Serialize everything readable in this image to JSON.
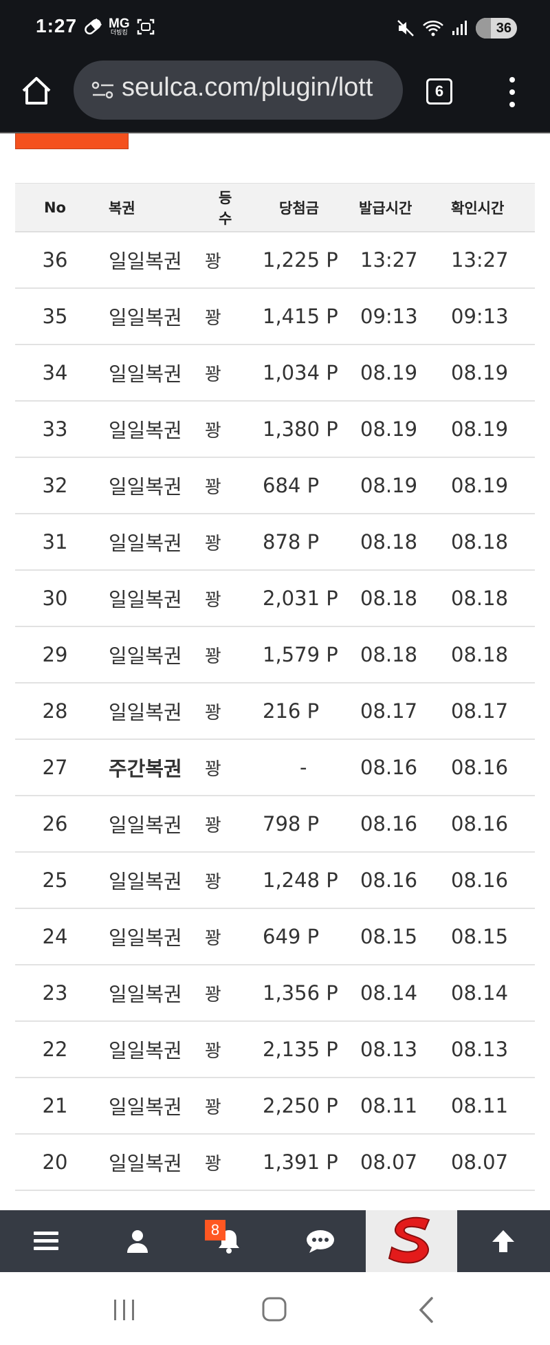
{
  "status_bar": {
    "time": "1:27",
    "carrier_top": "MG",
    "carrier_sub": "더빙킹",
    "battery": "36"
  },
  "browser": {
    "url": "seulca.com/plugin/lott",
    "tab_count": "6"
  },
  "table": {
    "headers": {
      "no": "No",
      "lottery": "복권",
      "rank": "등수",
      "prize": "당첨금",
      "issued": "발급시간",
      "checked": "확인시간"
    },
    "rows": [
      {
        "no": "36",
        "lottery": "일일복권",
        "rank": "꽝",
        "prize": "1,225 P",
        "issued": "13:27",
        "checked": "13:27"
      },
      {
        "no": "35",
        "lottery": "일일복권",
        "rank": "꽝",
        "prize": "1,415 P",
        "issued": "09:13",
        "checked": "09:13"
      },
      {
        "no": "34",
        "lottery": "일일복권",
        "rank": "꽝",
        "prize": "1,034 P",
        "issued": "08.19",
        "checked": "08.19"
      },
      {
        "no": "33",
        "lottery": "일일복권",
        "rank": "꽝",
        "prize": "1,380 P",
        "issued": "08.19",
        "checked": "08.19"
      },
      {
        "no": "32",
        "lottery": "일일복권",
        "rank": "꽝",
        "prize": "684 P",
        "issued": "08.19",
        "checked": "08.19"
      },
      {
        "no": "31",
        "lottery": "일일복권",
        "rank": "꽝",
        "prize": "878 P",
        "issued": "08.18",
        "checked": "08.18"
      },
      {
        "no": "30",
        "lottery": "일일복권",
        "rank": "꽝",
        "prize": "2,031 P",
        "issued": "08.18",
        "checked": "08.18"
      },
      {
        "no": "29",
        "lottery": "일일복권",
        "rank": "꽝",
        "prize": "1,579 P",
        "issued": "08.18",
        "checked": "08.18"
      },
      {
        "no": "28",
        "lottery": "일일복권",
        "rank": "꽝",
        "prize": "216 P",
        "issued": "08.17",
        "checked": "08.17"
      },
      {
        "no": "27",
        "lottery": "주간복권",
        "rank": "꽝",
        "prize": "-",
        "issued": "08.16",
        "checked": "08.16"
      },
      {
        "no": "26",
        "lottery": "일일복권",
        "rank": "꽝",
        "prize": "798 P",
        "issued": "08.16",
        "checked": "08.16"
      },
      {
        "no": "25",
        "lottery": "일일복권",
        "rank": "꽝",
        "prize": "1,248 P",
        "issued": "08.16",
        "checked": "08.16"
      },
      {
        "no": "24",
        "lottery": "일일복권",
        "rank": "꽝",
        "prize": "649 P",
        "issued": "08.15",
        "checked": "08.15"
      },
      {
        "no": "23",
        "lottery": "일일복권",
        "rank": "꽝",
        "prize": "1,356 P",
        "issued": "08.14",
        "checked": "08.14"
      },
      {
        "no": "22",
        "lottery": "일일복권",
        "rank": "꽝",
        "prize": "2,135 P",
        "issued": "08.13",
        "checked": "08.13"
      },
      {
        "no": "21",
        "lottery": "일일복권",
        "rank": "꽝",
        "prize": "2,250 P",
        "issued": "08.11",
        "checked": "08.11"
      },
      {
        "no": "20",
        "lottery": "일일복권",
        "rank": "꽝",
        "prize": "1,391 P",
        "issued": "08.07",
        "checked": "08.07"
      }
    ]
  },
  "bottom_nav": {
    "items": [
      {
        "icon": "menu-icon"
      },
      {
        "icon": "user-icon"
      },
      {
        "icon": "bell-icon",
        "badge": "8"
      },
      {
        "icon": "chat-icon"
      },
      {
        "icon": "site-logo"
      },
      {
        "icon": "arrow-up-icon"
      }
    ]
  },
  "colors": {
    "accent": "#f4511e",
    "nav_bg": "#363b44",
    "browser_bg": "#131519",
    "logo_red": "#e31b1b"
  }
}
